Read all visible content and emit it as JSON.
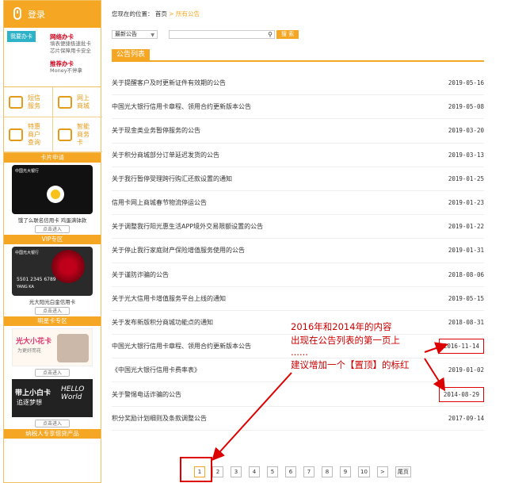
{
  "sidebar": {
    "login": "登录",
    "apply_tag": "我要办卡",
    "online_title": "网络办卡",
    "online_desc": [
      "填表便捷极速批卡",
      "芯片保障用卡安全"
    ],
    "recommend_title": "推荐办卡",
    "recommend_desc": "Money不停拿",
    "grid": [
      {
        "label": "短信服务",
        "icon": "envelope-icon"
      },
      {
        "label": "网上商城",
        "icon": "cart-icon"
      },
      {
        "label": "特惠商户查询",
        "icon": "discount-icon"
      },
      {
        "label": "智能商务卡",
        "icon": "smart-card-icon"
      }
    ],
    "card_apply_header": "卡片申请",
    "card1_caption": "饿了么联名信用卡  鸡蛋满钵款",
    "enter_label": "点击进入",
    "vip_header": "VIP专区",
    "card2_caption": "光大阳光白金信用卡",
    "star_header": "明星卡专区",
    "star1_title": "光大小花卡",
    "star1_sub": "为更好而花",
    "star2_title": "带上小白卡",
    "star2_sub": "追逐梦想",
    "star2_logo": "HELLO World",
    "footer_header": "纳税人专享借贷产品",
    "card_bank_text": "中国光大银行",
    "card_number": "5501 2345 6789",
    "card_holder": "YANG KA"
  },
  "breadcrumb": {
    "prefix": "您现在的位置：",
    "home": "首页",
    "sep": " > ",
    "current": "所有公告"
  },
  "filter": {
    "select_value": "最新公告",
    "search_button": "搜 索"
  },
  "list_title": "公告列表",
  "rows": [
    {
      "title": "关于提醒客户及时更新证件有效期的公告",
      "date": "2019-05-16"
    },
    {
      "title": "中国光大银行信用卡章程、领用合约更新版本公告",
      "date": "2019-05-08"
    },
    {
      "title": "关于现金类业务暂停服务的公告",
      "date": "2019-03-20"
    },
    {
      "title": "关于积分商城部分订单延迟发货的公告",
      "date": "2019-03-13"
    },
    {
      "title": "关于我行暂停受理跨行购汇还款设置的通知",
      "date": "2019-01-25"
    },
    {
      "title": "信用卡网上商城春节物流停运公告",
      "date": "2019-01-23"
    },
    {
      "title": "关于调整我行阳光惠生活APP境外交易限额设置的公告",
      "date": "2019-01-22"
    },
    {
      "title": "关于停止我行家庭财产保险增值服务使用的公告",
      "date": "2019-01-31"
    },
    {
      "title": "关于谨防诈骗的公告",
      "date": "2018-08-06"
    },
    {
      "title": "关于光大信用卡增值服务平台上线的通知",
      "date": "2019-05-15"
    },
    {
      "title": "关于发布新版积分商城功能点的通知",
      "date": "2018-08-31"
    },
    {
      "title": "中国光大银行信用卡章程、领用合约更新版本公告",
      "date": "2016-11-14"
    },
    {
      "title": "《中国光大银行信用卡费率表》",
      "date": "2019-01-02"
    },
    {
      "title": "关于警惕电话诈骗的公告",
      "date": "2014-08-29"
    },
    {
      "title": "积分奖励计划细则及条款调整公告",
      "date": "2017-09-14"
    }
  ],
  "pager": [
    "1",
    "2",
    "3",
    "4",
    "5",
    "6",
    "7",
    "8",
    "9",
    "10",
    ">",
    "尾页"
  ],
  "annotation": {
    "line1": "2016年和2014年的内容",
    "line2": "出现在公告列表的第一页上",
    "line3": "......",
    "line4": "建议增加一个【置顶】的标红"
  },
  "colors": {
    "accent": "#f5a623",
    "annotation": "#dd0000"
  }
}
